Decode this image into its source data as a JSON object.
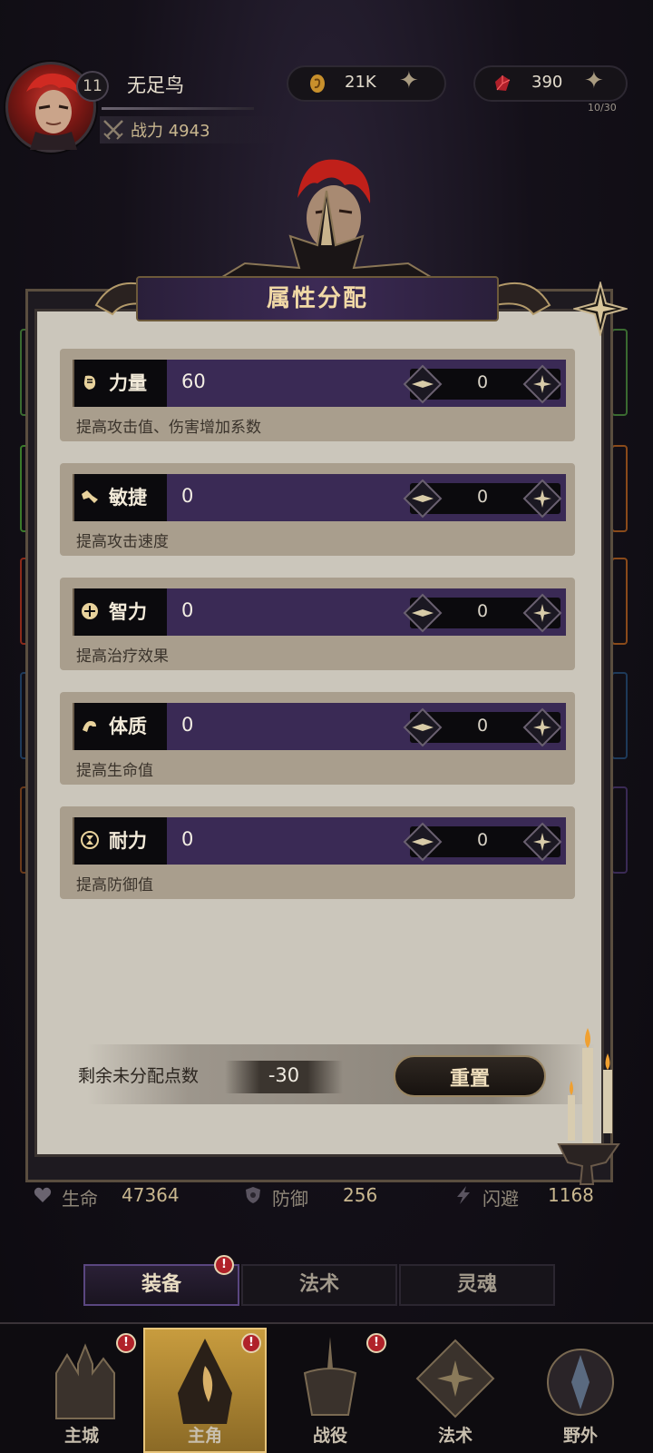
{
  "player": {
    "name": "无足鸟",
    "level": "11",
    "power_label": "战力 4943",
    "gold": "21K",
    "gems": "390",
    "stamina": "10/30"
  },
  "panel": {
    "title": "属性分配",
    "attributes": [
      {
        "label": "力量",
        "value": "60",
        "alloc": "0",
        "desc": "提高攻击值、伤害增加系数",
        "icon": "fist-icon"
      },
      {
        "label": "敏捷",
        "value": "0",
        "alloc": "0",
        "desc": "提高攻击速度",
        "icon": "dash-icon"
      },
      {
        "label": "智力",
        "value": "0",
        "alloc": "0",
        "desc": "提高治疗效果",
        "icon": "mind-icon"
      },
      {
        "label": "体质",
        "value": "0",
        "alloc": "0",
        "desc": "提高生命值",
        "icon": "arm-icon"
      },
      {
        "label": "耐力",
        "value": "0",
        "alloc": "0",
        "desc": "提高防御值",
        "icon": "hourglass-icon"
      }
    ],
    "remaining_label": "剩余未分配点数",
    "remaining_value": "-30",
    "reset_label": "重置"
  },
  "stats": [
    {
      "label": "生命",
      "value": "47364",
      "icon": "heart-icon"
    },
    {
      "label": "防御",
      "value": "256",
      "icon": "shield-icon"
    },
    {
      "label": "闪避",
      "value": "1168",
      "icon": "lightning-icon"
    }
  ],
  "subtabs": [
    {
      "label": "装备",
      "badge": "!"
    },
    {
      "label": "法术"
    },
    {
      "label": "灵魂"
    }
  ],
  "nav": [
    {
      "label": "主城",
      "badge": "!"
    },
    {
      "label": "主角",
      "badge": "!"
    },
    {
      "label": "战役",
      "badge": "!"
    },
    {
      "label": "法术"
    },
    {
      "label": "野外"
    }
  ],
  "colors": {
    "accent_purple": "#3a2a55",
    "gold_text": "#c9b78f",
    "badge_red": "#b0222a"
  }
}
